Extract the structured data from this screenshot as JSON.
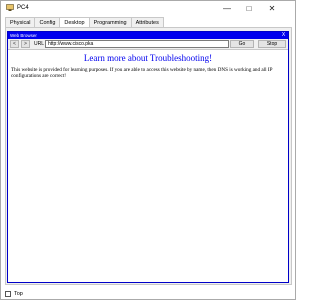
{
  "window": {
    "title": "PC4",
    "controls": {
      "minimize": "—",
      "maximize": "□",
      "close": "✕"
    },
    "icon": "pc-icon"
  },
  "tabs": [
    {
      "label": "Physical"
    },
    {
      "label": "Config"
    },
    {
      "label": "Desktop",
      "active": true
    },
    {
      "label": "Programming"
    },
    {
      "label": "Attributes"
    }
  ],
  "browser": {
    "header_title": "Web Browser",
    "close_label": "X",
    "back_label": "<",
    "forward_label": ">",
    "url_label": "URL",
    "url_value": "http://www.cisco.pka",
    "go_label": "Go",
    "stop_label": "Stop",
    "page_heading": "Learn more about Troubleshooting!",
    "page_body": "This website is provided for learning purposes. If you are able to access this website by name, then DNS is working and all IP configurations are correct!"
  },
  "footer": {
    "top_label": "Top",
    "top_checked": false
  },
  "colors": {
    "browser_header": "#0000ee",
    "link_heading": "#0000ee",
    "panel_bg": "#f0f0f0"
  }
}
